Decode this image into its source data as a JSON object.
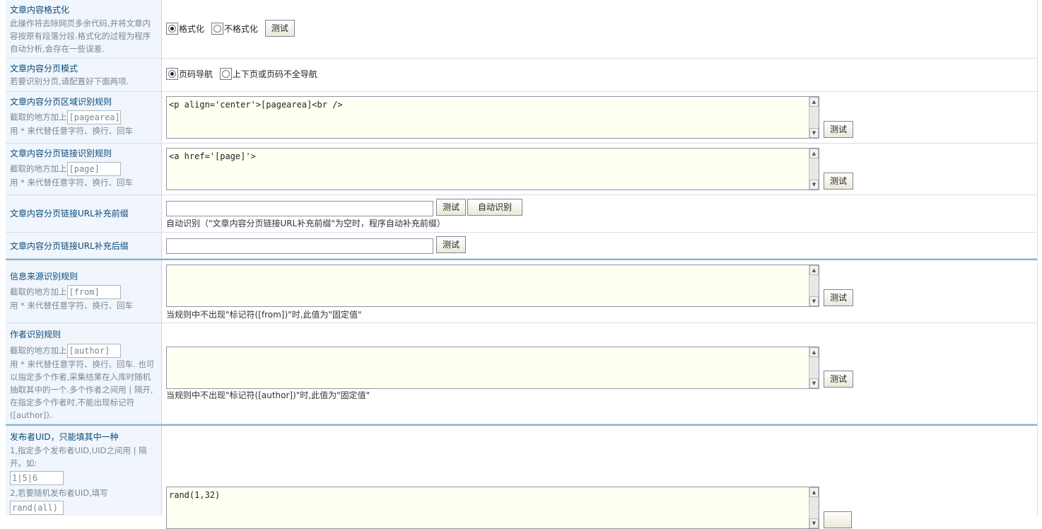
{
  "format": {
    "title": "文章内容格式化",
    "desc": "此操作将去除网页多余代码,并将文章内容按原有段落分段.格式化的过程为程序自动分析,会存在一些误差.",
    "opt1": "格式化",
    "opt2": "不格式化",
    "selected": "格式化",
    "test": "测试"
  },
  "paging_mode": {
    "title": "文章内容分页模式",
    "desc": "若要识别分页,请配置好下面两项.",
    "opt1": "页码导航",
    "opt2": "上下页或页码不全导航",
    "selected": "页码导航"
  },
  "page_area": {
    "title": "文章内容分页区域识别规则",
    "desc_prefix": "截取的地方加上",
    "tag": "[pagearea]",
    "desc_suffix": "用 * 来代替任意字符、换行、回车",
    "value": "<p align='center'>[pagearea]<br />",
    "test": "测试"
  },
  "page_link": {
    "title": "文章内容分页链接识别规则",
    "desc_prefix": "截取的地方加上",
    "tag": "[page]",
    "desc_suffix": "用 * 来代替任意字符、换行、回车",
    "value": "<a href='[page]'>",
    "test": "测试"
  },
  "url_prefix": {
    "title": "文章内容分页链接URL补充前缀",
    "value": "",
    "test": "测试",
    "auto": "自动识别",
    "hint": "自动识别（\"文章内容分页链接URL补充前缀\"为空时，程序自动补充前缀）"
  },
  "url_suffix": {
    "title": "文章内容分页链接URL补充后缀",
    "value": "",
    "test": "测试"
  },
  "from": {
    "title": "信息来源识别规则",
    "desc_prefix": "截取的地方加上",
    "tag": "[from]",
    "desc_suffix": "用 * 来代替任意字符、换行、回车",
    "value": "",
    "test": "测试",
    "hint": "当规则中不出现\"标记符([from])\"时,此值为\"固定值\""
  },
  "author": {
    "title": "作者识别规则",
    "desc_prefix": "截取的地方加上",
    "tag": "[author]",
    "desc_suffix": "用 * 来代替任意字符、换行、回车. 也可以指定多个作者,采集结果在入库时随机抽取其中的一个.多个作者之间用 | 隔开,在指定多个作者时,不能出现标记符([author]).",
    "value": "",
    "test": "测试",
    "hint": "当规则中不出现\"标记符([author])\"时,此值为\"固定值\""
  },
  "uid": {
    "title": "发布者UID，只能填其中一种",
    "desc1": "1,指定多个发布者UID,UID之间用 | 隔开。如:",
    "example1": "1|5|6",
    "desc2": "2,若要随机发布者UID,填写",
    "example2": "rand(all)",
    "value": "rand(1,32)"
  }
}
